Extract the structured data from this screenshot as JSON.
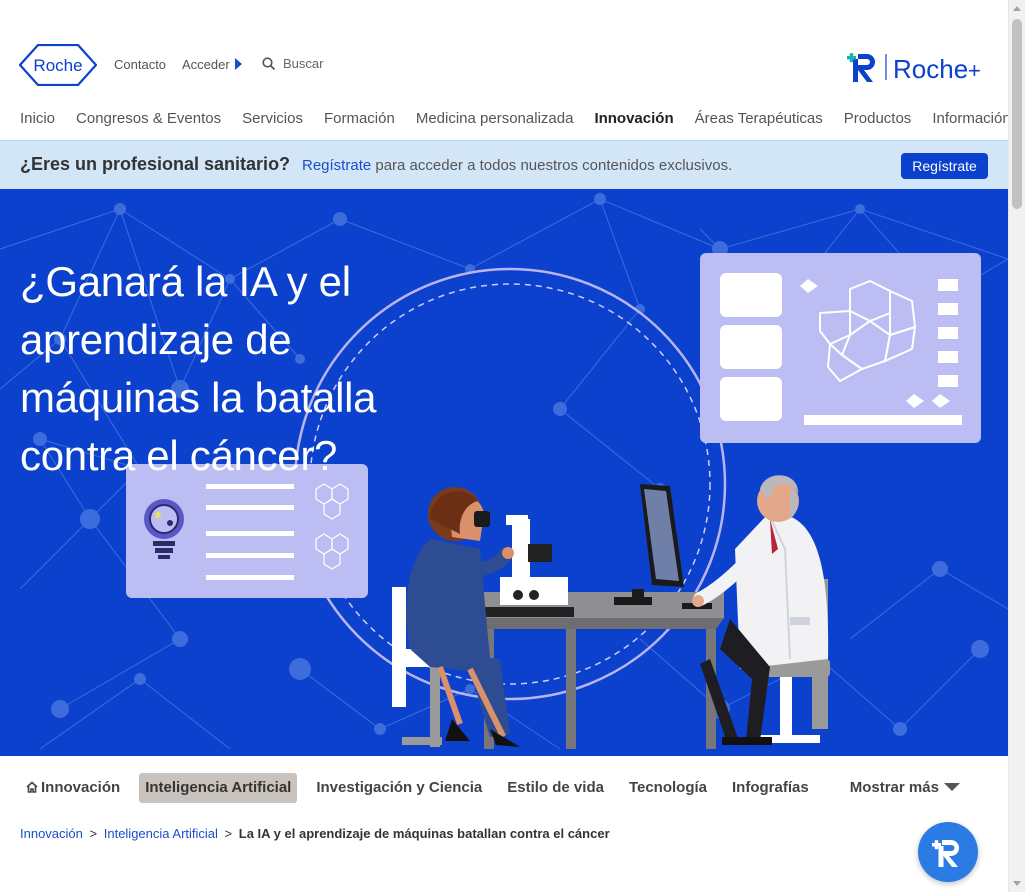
{
  "header": {
    "logo_text": "Roche",
    "contact_label": "Contacto",
    "login_label": "Acceder",
    "search_placeholder": "Buscar",
    "rocheplus_text": "Roche",
    "rocheplus_suffix": "+"
  },
  "main_nav": [
    {
      "label": "Inicio"
    },
    {
      "label": "Congresos & Eventos"
    },
    {
      "label": "Servicios"
    },
    {
      "label": "Formación"
    },
    {
      "label": "Medicina personalizada"
    },
    {
      "label": "Innovación",
      "active": true
    },
    {
      "label": "Áreas Terapéuticas"
    },
    {
      "label": "Productos"
    },
    {
      "label": "Información Médica"
    }
  ],
  "pro_banner": {
    "question": "¿Eres un profesional sanitario?",
    "link_text": "Regístrate",
    "rest_text": " para acceder a todos nuestros contenidos exclusivos.",
    "button_label": "Regístrate"
  },
  "hero": {
    "title": "¿Ganará la IA y el aprendizaje de máquinas la batalla contra el cáncer?"
  },
  "sub_nav": {
    "home_label": "Innovación",
    "tabs": [
      {
        "label": "Inteligencia Artificial",
        "active": true
      },
      {
        "label": "Investigación y Ciencia"
      },
      {
        "label": "Estilo de vida"
      },
      {
        "label": "Tecnología"
      },
      {
        "label": "Infografías"
      }
    ],
    "more_label": "Mostrar más"
  },
  "breadcrumb": {
    "items": [
      "Innovación",
      "Inteligencia Artificial"
    ],
    "separator": ">",
    "current": "La IA y el aprendizaje de máquinas batallan contra el cáncer"
  },
  "colors": {
    "brand_blue": "#0b41cd",
    "hero_blue": "#0b41cd",
    "banner_bg": "#d3e6f8",
    "link_blue": "#1a4ec9",
    "active_tab_bg": "#c9c2bd",
    "panel_lavender": "#bcbdf2"
  }
}
